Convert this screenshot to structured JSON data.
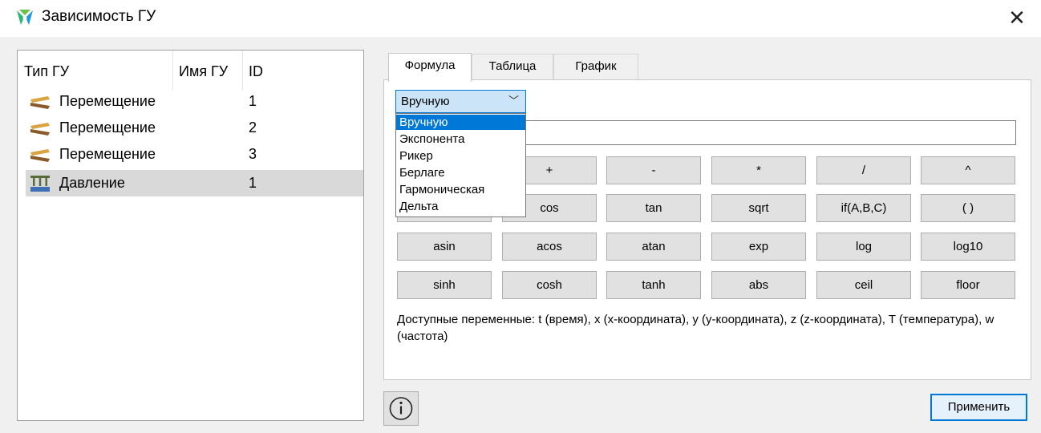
{
  "window": {
    "title": "Зависимость ГУ",
    "close_glyph": "✕",
    "icon": "app-logo-icon"
  },
  "tree": {
    "columns": [
      "Тип ГУ",
      "Имя ГУ",
      "ID"
    ],
    "rows": [
      {
        "type": "Перемещение",
        "name": "",
        "id": "1",
        "icon": "displacement-icon",
        "selected": false
      },
      {
        "type": "Перемещение",
        "name": "",
        "id": "2",
        "icon": "displacement-icon",
        "selected": false
      },
      {
        "type": "Перемещение",
        "name": "",
        "id": "3",
        "icon": "displacement-icon",
        "selected": false
      },
      {
        "type": "Давление",
        "name": "",
        "id": "1",
        "icon": "pressure-icon",
        "selected": true
      }
    ]
  },
  "tabs": [
    {
      "label": "Формула",
      "active": true
    },
    {
      "label": "Таблица",
      "active": false
    },
    {
      "label": "График",
      "active": false
    }
  ],
  "formula": {
    "mode_selected": "Вручную",
    "mode_options": [
      "Вручную",
      "Экспонента",
      "Рикер",
      "Берлаге",
      "Гармоническая",
      "Дельта"
    ],
    "highlighted_option": "Вручную",
    "input_value": ""
  },
  "buttons": {
    "row1": [
      "",
      "+",
      "-",
      "*",
      "/",
      "^"
    ],
    "row2": [
      "",
      "cos",
      "tan",
      "sqrt",
      "if(A,B,C)",
      "(  )"
    ],
    "row3": [
      "asin",
      "acos",
      "atan",
      "exp",
      "log",
      "log10"
    ],
    "row4": [
      "sinh",
      "cosh",
      "tanh",
      "abs",
      "ceil",
      "floor"
    ]
  },
  "variables_text": "Доступные переменные: t (время), x (x-координата), y (y-координата), z (z-координата), T (температура), w (частота)",
  "footer": {
    "info_icon": "info-icon",
    "apply_label": "Применить"
  },
  "colors": {
    "accent": "#0078d7",
    "selection": "#d9d9d9",
    "button_face": "#e1e1e1"
  }
}
